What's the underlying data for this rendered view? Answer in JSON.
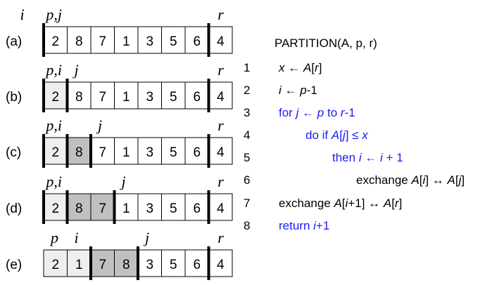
{
  "colors": {
    "light": "#eeeeee",
    "dark": "#c0c0c0",
    "white": "#ffffff",
    "keyword": "#1a1aff",
    "border": "#000000"
  },
  "rows": [
    {
      "tag": "(a)",
      "cells": [
        "2",
        "8",
        "7",
        "1",
        "3",
        "5",
        "6",
        "4"
      ],
      "shades": [
        "white",
        "white",
        "white",
        "white",
        "white",
        "white",
        "white",
        "white"
      ],
      "thick": [
        0,
        7
      ],
      "markers": [
        {
          "text": "i",
          "cell": -1.0
        },
        {
          "text": "p,j",
          "cell": 0.1
        },
        {
          "text": "r",
          "cell": 7.0
        }
      ]
    },
    {
      "tag": "(b)",
      "cells": [
        "2",
        "8",
        "7",
        "1",
        "3",
        "5",
        "6",
        "4"
      ],
      "shades": [
        "light",
        "white",
        "white",
        "white",
        "white",
        "white",
        "white",
        "white"
      ],
      "thick": [
        0,
        1,
        7
      ],
      "markers": [
        {
          "text": "p,i",
          "cell": 0.1
        },
        {
          "text": "j",
          "cell": 1.3
        },
        {
          "text": "r",
          "cell": 7.0
        }
      ]
    },
    {
      "tag": "(c)",
      "cells": [
        "2",
        "8",
        "7",
        "1",
        "3",
        "5",
        "6",
        "4"
      ],
      "shades": [
        "light",
        "dark",
        "white",
        "white",
        "white",
        "white",
        "white",
        "white"
      ],
      "thick": [
        0,
        1,
        2,
        7
      ],
      "markers": [
        {
          "text": "p,i",
          "cell": 0.1
        },
        {
          "text": "j",
          "cell": 2.3
        },
        {
          "text": "r",
          "cell": 7.0
        }
      ]
    },
    {
      "tag": "(d)",
      "cells": [
        "2",
        "8",
        "7",
        "1",
        "3",
        "5",
        "6",
        "4"
      ],
      "shades": [
        "light",
        "dark",
        "dark",
        "white",
        "white",
        "white",
        "white",
        "white"
      ],
      "thick": [
        0,
        1,
        3,
        7
      ],
      "markers": [
        {
          "text": "p,i",
          "cell": 0.1
        },
        {
          "text": "j",
          "cell": 3.3
        },
        {
          "text": "r",
          "cell": 7.0
        }
      ]
    },
    {
      "tag": "(e)",
      "cells": [
        "2",
        "1",
        "7",
        "8",
        "3",
        "5",
        "6",
        "4"
      ],
      "shades": [
        "light",
        "light",
        "dark",
        "dark",
        "white",
        "white",
        "white",
        "white"
      ],
      "thick": [
        2,
        4,
        7
      ],
      "markers": [
        {
          "text": "p",
          "cell": 0.3
        },
        {
          "text": "i",
          "cell": 1.3
        },
        {
          "text": "j",
          "cell": 4.3
        },
        {
          "text": "r",
          "cell": 7.0
        }
      ]
    }
  ],
  "code": {
    "title": "PARTITION(A, p, r)",
    "line_numbers": [
      "1",
      "2",
      "3",
      "4",
      "5",
      "6",
      "7",
      "8"
    ],
    "l1_x": "x",
    "l1_arrow": " ← ",
    "l1_a": "A",
    "l1_br1": "[",
    "l1_r": "r",
    "l1_br2": "]",
    "l2_i": "i",
    "l2_arrow": " ← ",
    "l2_p": "p",
    "l2_rest": "-1",
    "l3_for": "for ",
    "l3_j": "j",
    "l3_arrow": " ← ",
    "l3_p": "p",
    "l3_to": "  to ",
    "l3_r": "r",
    "l3_rest": "-1",
    "l4_do": "do if ",
    "l4_a": "A",
    "l4_br1": "[",
    "l4_j": "j",
    "l4_br2": "]",
    "l4_leq": " ≤ ",
    "l4_x": "x",
    "l5_then": "then ",
    "l5_i": "i",
    "l5_arrow": " ← ",
    "l5_i2": "i",
    "l5_rest": " + 1",
    "l6_ex": "exchange ",
    "l6_a": "A",
    "l6_b1": "[",
    "l6_i": "i",
    "l6_b2": "]",
    "l6_sw": " ↔ ",
    "l6_a2": "A",
    "l6_b3": "[",
    "l6_j": "j",
    "l6_b4": "]",
    "l7_ex": "exchange ",
    "l7_a": "A",
    "l7_b1": "[",
    "l7_i": "i",
    "l7_b2": "+1]",
    "l7_sw": " ↔ ",
    "l7_a2": "A",
    "l7_b3": "[",
    "l7_r": "r",
    "l7_b4": "]",
    "l8_ret": "return ",
    "l8_i": "i",
    "l8_rest": "+1"
  }
}
